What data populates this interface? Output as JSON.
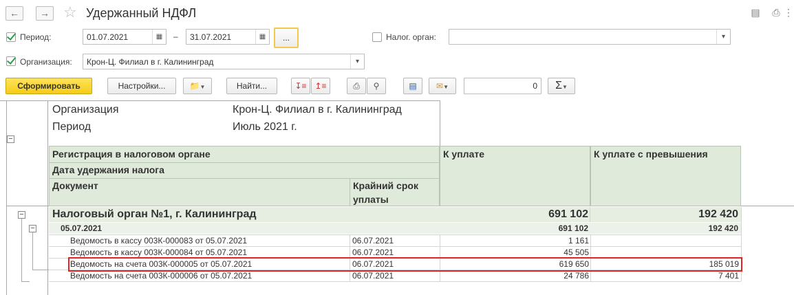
{
  "window": {
    "title": "Удержанный НДФЛ"
  },
  "nav": {
    "back": "←",
    "forward": "→",
    "star": "☆"
  },
  "filters": {
    "period_label": "Период:",
    "period_from": "01.07.2021",
    "dash": "–",
    "period_to": "31.07.2021",
    "ellipsis": "...",
    "tax_label": "Налог. орган:",
    "tax_value": "",
    "org_label": "Организация:",
    "org_value": "Крон-Ц. Филиал в г. Калининград"
  },
  "toolbar": {
    "generate": "Сформировать",
    "settings": "Настройки...",
    "find": "Найти...",
    "sum_value": "0",
    "sigma": "Σ"
  },
  "report": {
    "org_label": "Организация",
    "org_value": "Крон-Ц. Филиал в г. Калининград",
    "period_label": "Период",
    "period_value": "Июль 2021 г.",
    "h_reg": "Регистрация в налоговом органе",
    "h_date": "Дата удержания налога",
    "h_doc": "Документ",
    "h_deadline_1": "Крайний срок",
    "h_deadline_2": "уплаты",
    "h_pay": "К уплате",
    "h_pay_excess": "К уплате с превышения",
    "group": {
      "name": "Налоговый орган №1, г. Калининград",
      "pay": "691 102",
      "excess": "192 420"
    },
    "subgroup": {
      "date": "05.07.2021",
      "pay": "691 102",
      "excess": "192 420"
    },
    "rows": [
      {
        "doc": "Ведомость в кассу 003К-000083 от 05.07.2021",
        "deadline": "06.07.2021",
        "pay": "1 161",
        "excess": ""
      },
      {
        "doc": "Ведомость в кассу 003К-000084 от 05.07.2021",
        "deadline": "06.07.2021",
        "pay": "45 505",
        "excess": ""
      },
      {
        "doc": "Ведомость на счета 003К-000005 от 05.07.2021",
        "deadline": "06.07.2021",
        "pay": "619 650",
        "excess": "185 019"
      },
      {
        "doc": "Ведомость на счета 003К-000006 от 05.07.2021",
        "deadline": "06.07.2021",
        "pay": "24 786",
        "excess": "7 401"
      }
    ]
  },
  "colors": {
    "highlight": "#e02424",
    "header_bg": "#dfeadb",
    "accent_button": "#f5cc17"
  }
}
